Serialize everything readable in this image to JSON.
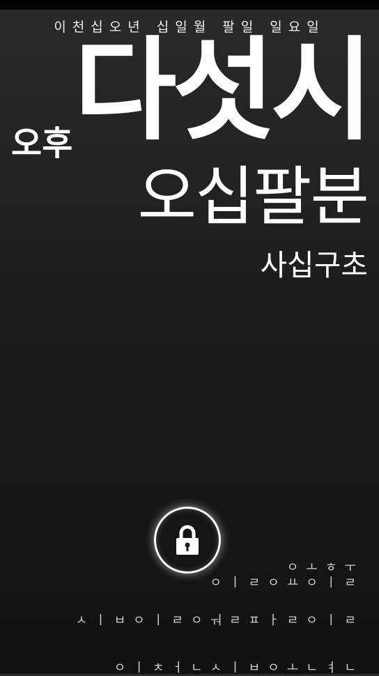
{
  "date": "이천십오년 십일월 팔일 일요일",
  "time": {
    "ampm": "오후",
    "hour": "다섯시",
    "minute": "오십팔분",
    "second": "사십구초"
  },
  "lock": {
    "icon": "padlock-icon"
  },
  "hints": {
    "line1": "ㅇㅗㅎㅜ",
    "line2": "ㅇㅣㄹㅇㅛㅇㅣㄹ",
    "line3": "ㅅㅣㅂㅇㅣㄹㅇㅝㄹㅍㅏㄹㅇㅣㄹ",
    "line4": "ㅇㅣㅊㅓㄴㅅㅣㅂㅇㅗㄴㅕㄴ"
  }
}
